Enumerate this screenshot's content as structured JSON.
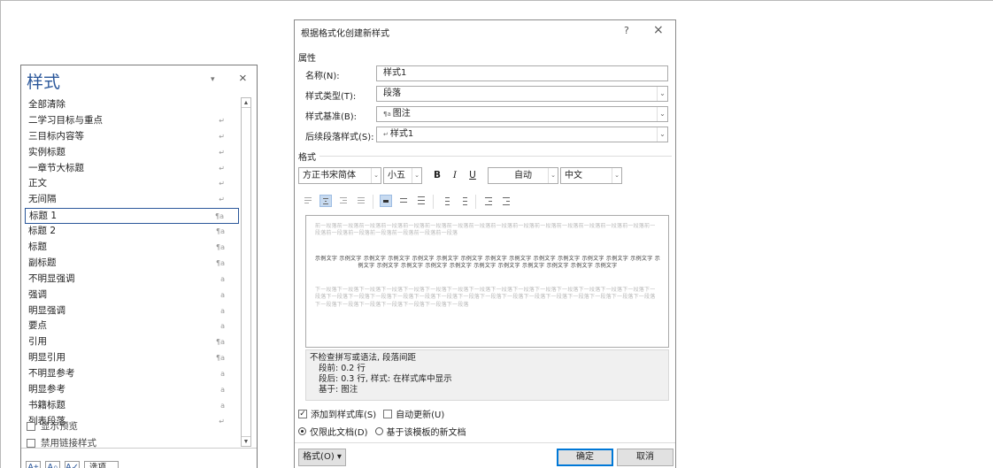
{
  "styles_pane": {
    "title": "样式",
    "dropdown_glyph": "▾",
    "close_glyph": "×",
    "items": [
      {
        "label": "全部清除",
        "mark": ""
      },
      {
        "label": "二学习目标与重点",
        "mark": "↵"
      },
      {
        "label": "三目标内容等",
        "mark": "↵"
      },
      {
        "label": "实例标题",
        "mark": "↵"
      },
      {
        "label": "一章节大标题",
        "mark": "↵"
      },
      {
        "label": "正文",
        "mark": "↵"
      },
      {
        "label": "无间隔",
        "mark": "↵"
      },
      {
        "label": "标题 1",
        "mark": "¶a"
      },
      {
        "label": "标题 2",
        "mark": "¶a"
      },
      {
        "label": "标题",
        "mark": "¶a"
      },
      {
        "label": "副标题",
        "mark": "¶a"
      },
      {
        "label": "不明显强调",
        "mark": "a"
      },
      {
        "label": "强调",
        "mark": "a"
      },
      {
        "label": "明显强调",
        "mark": "a"
      },
      {
        "label": "要点",
        "mark": "a"
      },
      {
        "label": "引用",
        "mark": "¶a"
      },
      {
        "label": "明显引用",
        "mark": "¶a"
      },
      {
        "label": "不明显参考",
        "mark": "a"
      },
      {
        "label": "明显参考",
        "mark": "a"
      },
      {
        "label": "书籍标题",
        "mark": "a"
      },
      {
        "label": "列表段落",
        "mark": "↵"
      }
    ],
    "selected_index": 7,
    "show_preview_label": "显示预览",
    "disable_linked_label": "禁用链接样式",
    "options_label": "选项..."
  },
  "dialog": {
    "title": "根据格式化创建新样式",
    "help_glyph": "?",
    "close_glyph": "×",
    "properties_label": "属性",
    "name_label": "名称(N):",
    "name_value": "样式1",
    "type_label": "样式类型(T):",
    "type_value": "段落",
    "based_on_label": "样式基准(B):",
    "based_on_value": "图注",
    "next_label": "后续段落样式(S):",
    "next_value": "样式1",
    "format_label": "格式",
    "font_value": "方正书宋简体",
    "size_value": "小五",
    "bold_glyph": "B",
    "italic_glyph": "I",
    "underline_glyph": "U",
    "color_value": "自动",
    "script_value": "中文",
    "prev_para_text": "前一段落前一段落前一段落前一段落前一段落前一段落前一段落前一段落前一段落前一段落前一段落前一段落前一段落前一段落前一段落前一段落前一段落前一段落前一段落前一段落前一段落前一段落",
    "sample_text": "示例文字 示例文字 示例文字 示例文字 示例文字 示例文字 示例文字 示例文字 示例文字 示例文字 示例文字 示例文字 示例文字 示例文字 示例文字 示例文字 示例文字 示例文字 示例文字 示例文字 示例文字 示例文字 示例文字 示例文字 示例文字",
    "next_para_text": "下一段落下一段落下一段落下一段落下一段落下一段落下一段落下一段落下一段落下一段落下一段落下一段落下一段落下一段落下一段落下一段落下一段落下一段落下一段落下一段落下一段落下一段落下一段落下一段落下一段落下一段落下一段落下一段落下一段落下一段落下一段落下一段落下一段落下一段落下一段落下一段落下一段落下一段落",
    "desc_line1": "不检查拼写或语法, 段落间距",
    "desc_line2": "段前: 0.2 行",
    "desc_line3": "段后: 0.3 行, 样式: 在样式库中显示",
    "desc_line4": "基于: 图注",
    "add_to_gallery_label": "添加到样式库(S)",
    "auto_update_label": "自动更新(U)",
    "this_doc_label": "仅限此文档(D)",
    "template_label": "基于该模板的新文档",
    "format_button": "格式(O) ▾",
    "ok_button": "确定",
    "cancel_button": "取消"
  }
}
